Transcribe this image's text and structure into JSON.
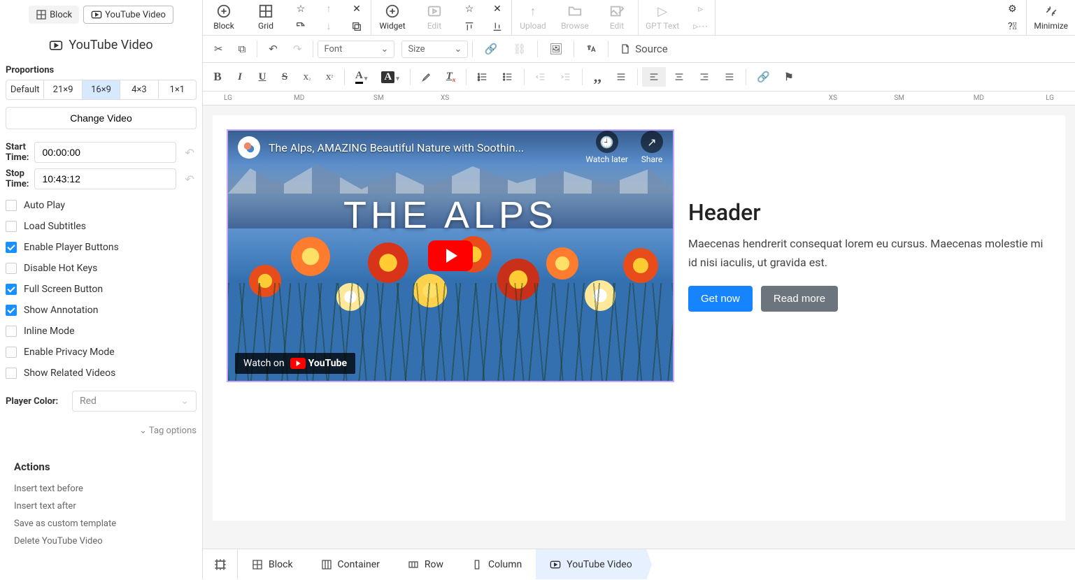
{
  "sidebar": {
    "tabs": {
      "block": "Block",
      "youtube": "YouTube Video"
    },
    "title": "YouTube Video",
    "proportions_label": "Proportions",
    "proportions": [
      "Default",
      "21×9",
      "16×9",
      "4×3",
      "1×1"
    ],
    "change_video": "Change Video",
    "start_time_label": "Start Time:",
    "start_time": "00:00:00",
    "stop_time_label": "Stop Time:",
    "stop_time": "10:43:12",
    "options": {
      "auto_play": "Auto Play",
      "load_subtitles": "Load Subtitles",
      "enable_player_buttons": "Enable Player Buttons",
      "disable_hotkeys": "Disable Hot Keys",
      "fullscreen": "Full Screen Button",
      "show_annotation": "Show Annotation",
      "inline_mode": "Inline Mode",
      "privacy": "Enable Privacy Mode",
      "related": "Show Related Videos"
    },
    "player_color_label": "Player Color:",
    "player_color": "Red",
    "tag_options": "Tag options",
    "actions_header": "Actions",
    "actions": {
      "insert_before": "Insert text before",
      "insert_after": "Insert text after",
      "save_template": "Save as custom template",
      "delete": "Delete YouTube Video"
    }
  },
  "topbar": {
    "block": "Block",
    "grid": "Grid",
    "widget": "Widget",
    "edit": "Edit",
    "upload": "Upload",
    "browse": "Browse",
    "edit2": "Edit",
    "gpt": "GPT Text",
    "minimize": "Minimize"
  },
  "formatbar": {
    "font": "Font",
    "size": "Size",
    "source": "Source"
  },
  "ruler": {
    "lg": "LG",
    "md": "MD",
    "sm": "SM",
    "xs": "XS"
  },
  "video": {
    "title": "The Alps, AMAZING Beautiful Nature with Soothin...",
    "watch_later": "Watch later",
    "share": "Share",
    "big_title": "THE ALPS",
    "watch_on": "Watch on",
    "youtube": "YouTube"
  },
  "content": {
    "header": "Header",
    "body": "Maecenas hendrerit consequat lorem eu cursus. Maecenas molestie mi id nisi iaculis, ut gravida est.",
    "get_now": "Get now",
    "read_more": "Read more"
  },
  "breadcrumb": {
    "block": "Block",
    "container": "Container",
    "row": "Row",
    "column": "Column",
    "youtube": "YouTube Video"
  }
}
